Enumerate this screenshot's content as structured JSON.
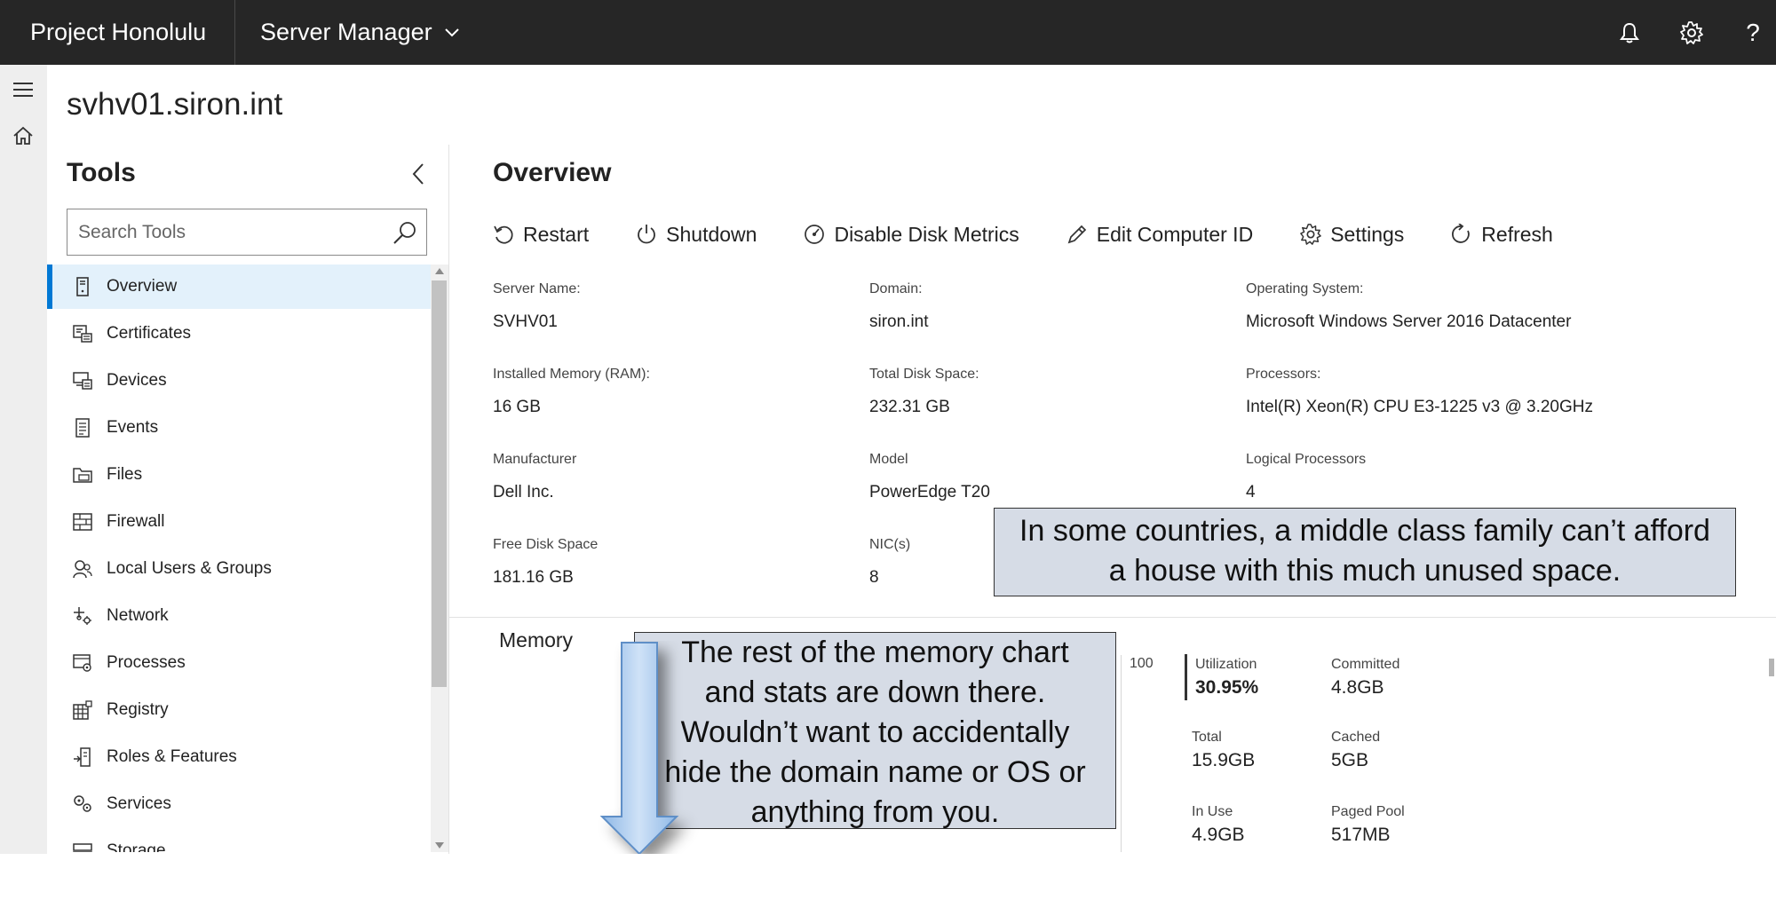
{
  "topbar": {
    "brand": "Project Honolulu",
    "app_switcher": "Server Manager",
    "icons": [
      "bell-icon",
      "gear-icon",
      "help-icon"
    ],
    "help_glyph": "?"
  },
  "rail": {
    "icons": [
      "hamburger-menu-icon",
      "home-icon"
    ]
  },
  "server": {
    "name": "svhv01.siron.int"
  },
  "tools": {
    "title": "Tools",
    "search_placeholder": "Search Tools",
    "items": [
      {
        "label": "Overview",
        "icon": "server-icon",
        "active": true
      },
      {
        "label": "Certificates",
        "icon": "certificate-icon"
      },
      {
        "label": "Devices",
        "icon": "devices-icon"
      },
      {
        "label": "Events",
        "icon": "events-icon"
      },
      {
        "label": "Files",
        "icon": "folder-icon"
      },
      {
        "label": "Firewall",
        "icon": "firewall-icon"
      },
      {
        "label": "Local Users & Groups",
        "icon": "users-icon"
      },
      {
        "label": "Network",
        "icon": "network-icon"
      },
      {
        "label": "Processes",
        "icon": "processes-icon"
      },
      {
        "label": "Registry",
        "icon": "registry-icon"
      },
      {
        "label": "Roles & Features",
        "icon": "roles-icon"
      },
      {
        "label": "Services",
        "icon": "services-icon"
      },
      {
        "label": "Storage",
        "icon": "storage-icon"
      }
    ]
  },
  "overview": {
    "title": "Overview",
    "actions": [
      {
        "label": "Restart",
        "icon": "restart-icon"
      },
      {
        "label": "Shutdown",
        "icon": "power-icon"
      },
      {
        "label": "Disable Disk Metrics",
        "icon": "disk-metrics-icon"
      },
      {
        "label": "Edit Computer ID",
        "icon": "pencil-icon"
      },
      {
        "label": "Settings",
        "icon": "gear-icon"
      },
      {
        "label": "Refresh",
        "icon": "refresh-icon"
      }
    ],
    "properties": [
      {
        "label": "Server Name:",
        "value": "SVHV01"
      },
      {
        "label": "Domain:",
        "value": "siron.int"
      },
      {
        "label": "Operating System:",
        "value": "Microsoft Windows Server 2016 Datacenter"
      },
      {
        "label": "Installed Memory (RAM):",
        "value": "16 GB"
      },
      {
        "label": "Total Disk Space:",
        "value": "232.31 GB"
      },
      {
        "label": "Processors:",
        "value": "Intel(R) Xeon(R) CPU E3-1225 v3 @ 3.20GHz"
      },
      {
        "label": "Manufacturer",
        "value": "Dell Inc."
      },
      {
        "label": "Model",
        "value": "PowerEdge T20"
      },
      {
        "label": "Logical Processors",
        "value": "4"
      },
      {
        "label": "Free Disk Space",
        "value": "181.16 GB"
      },
      {
        "label": "NIC(s)",
        "value": "8"
      }
    ]
  },
  "memory": {
    "title": "Memory",
    "axis_max": "100",
    "stats": [
      {
        "label": "Utilization",
        "value": "30.95%"
      },
      {
        "label": "Committed",
        "value": "4.8GB"
      },
      {
        "label": "Total",
        "value": "15.9GB"
      },
      {
        "label": "Cached",
        "value": "5GB"
      },
      {
        "label": "In Use",
        "value": "4.9GB"
      },
      {
        "label": "Paged Pool",
        "value": "517MB"
      }
    ]
  },
  "callouts": {
    "space": [
      "In some countries, a middle class family can’t afford",
      "a house with this much unused space."
    ],
    "memory": [
      "The rest of the memory chart",
      "and stats are down there.",
      "Wouldn’t want to accidentally",
      "hide the domain name or OS or",
      "anything from you."
    ]
  },
  "colors": {
    "topbar_bg": "#262626",
    "accent": "#0078d4",
    "active_item_bg": "#e3f1fb",
    "callout_bg": "#d6dce6",
    "arrow_fill": "#a7c9ee"
  }
}
